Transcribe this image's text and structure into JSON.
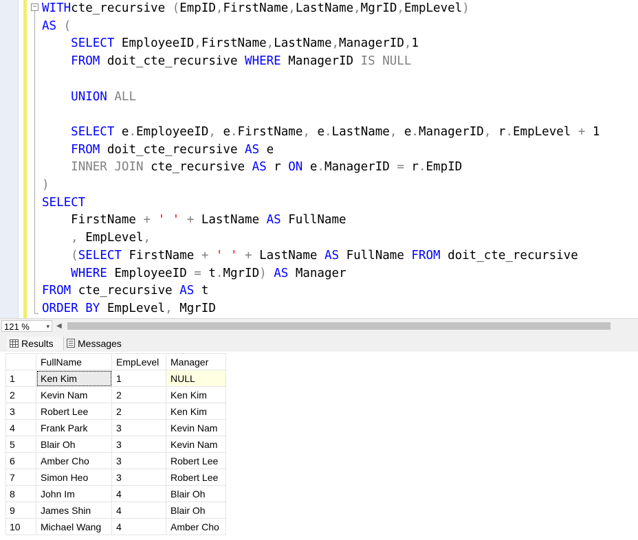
{
  "editor": {
    "fold_toggle": "−",
    "lines": [
      [
        [
          "kw",
          "WITH"
        ],
        [
          "",
          "cte_recursive "
        ],
        [
          "gr",
          "("
        ],
        [
          "",
          "EmpID"
        ],
        [
          "gr",
          ","
        ],
        [
          "",
          "FirstName"
        ],
        [
          "gr",
          ","
        ],
        [
          "",
          "LastName"
        ],
        [
          "gr",
          ","
        ],
        [
          "",
          "MgrID"
        ],
        [
          "gr",
          ","
        ],
        [
          "",
          "EmpLevel"
        ],
        [
          "gr",
          ")"
        ]
      ],
      [
        [
          "kw",
          "AS "
        ],
        [
          "gr",
          "("
        ]
      ],
      [
        [
          "",
          "    "
        ],
        [
          "kw",
          "SELECT "
        ],
        [
          "",
          "EmployeeID"
        ],
        [
          "gr",
          ","
        ],
        [
          "",
          "FirstName"
        ],
        [
          "gr",
          ","
        ],
        [
          "",
          "LastName"
        ],
        [
          "gr",
          ","
        ],
        [
          "",
          "ManagerID"
        ],
        [
          "gr",
          ","
        ],
        [
          "",
          "1"
        ]
      ],
      [
        [
          "",
          "    "
        ],
        [
          "kw",
          "FROM "
        ],
        [
          "",
          "doit_cte_recursive "
        ],
        [
          "kw",
          "WHERE "
        ],
        [
          "",
          "ManagerID "
        ],
        [
          "gr",
          "IS NULL"
        ]
      ],
      [],
      [
        [
          "",
          "    "
        ],
        [
          "kw",
          "UNION "
        ],
        [
          "gr",
          "ALL"
        ]
      ],
      [],
      [
        [
          "",
          "    "
        ],
        [
          "kw",
          "SELECT "
        ],
        [
          "",
          "e"
        ],
        [
          "gr",
          "."
        ],
        [
          "",
          "EmployeeID"
        ],
        [
          "gr",
          ", "
        ],
        [
          "",
          "e"
        ],
        [
          "gr",
          "."
        ],
        [
          "",
          "FirstName"
        ],
        [
          "gr",
          ", "
        ],
        [
          "",
          "e"
        ],
        [
          "gr",
          "."
        ],
        [
          "",
          "LastName"
        ],
        [
          "gr",
          ", "
        ],
        [
          "",
          "e"
        ],
        [
          "gr",
          "."
        ],
        [
          "",
          "ManagerID"
        ],
        [
          "gr",
          ", "
        ],
        [
          "",
          "r"
        ],
        [
          "gr",
          "."
        ],
        [
          "",
          "EmpLevel "
        ],
        [
          "gr",
          "+ "
        ],
        [
          "",
          "1"
        ]
      ],
      [
        [
          "",
          "    "
        ],
        [
          "kw",
          "FROM "
        ],
        [
          "",
          "doit_cte_recursive "
        ],
        [
          "kw",
          "AS "
        ],
        [
          "",
          "e"
        ]
      ],
      [
        [
          "",
          "    "
        ],
        [
          "gr",
          "INNER JOIN "
        ],
        [
          "",
          "cte_recursive "
        ],
        [
          "kw",
          "AS "
        ],
        [
          "",
          "r "
        ],
        [
          "kw",
          "ON "
        ],
        [
          "",
          "e"
        ],
        [
          "gr",
          "."
        ],
        [
          "",
          "ManagerID "
        ],
        [
          "gr",
          "= "
        ],
        [
          "",
          "r"
        ],
        [
          "gr",
          "."
        ],
        [
          "",
          "EmpID"
        ]
      ],
      [
        [
          "gr",
          ")"
        ]
      ],
      [
        [
          "kw",
          "SELECT"
        ]
      ],
      [
        [
          "",
          "    FirstName "
        ],
        [
          "gr",
          "+ "
        ],
        [
          "st",
          "' '"
        ],
        [
          "gr",
          " + "
        ],
        [
          "",
          "LastName "
        ],
        [
          "kw",
          "AS "
        ],
        [
          "",
          "FullName"
        ]
      ],
      [
        [
          "",
          "    "
        ],
        [
          "gr",
          ", "
        ],
        [
          "",
          "EmpLevel"
        ],
        [
          "gr",
          ","
        ]
      ],
      [
        [
          "",
          "    "
        ],
        [
          "gr",
          "("
        ],
        [
          "kw",
          "SELECT "
        ],
        [
          "",
          "FirstName "
        ],
        [
          "gr",
          "+ "
        ],
        [
          "st",
          "' '"
        ],
        [
          "gr",
          " + "
        ],
        [
          "",
          "LastName "
        ],
        [
          "kw",
          "AS "
        ],
        [
          "",
          "FullName "
        ],
        [
          "kw",
          "FROM "
        ],
        [
          "",
          "doit_cte_recursive"
        ]
      ],
      [
        [
          "",
          "    "
        ],
        [
          "kw",
          "WHERE "
        ],
        [
          "",
          "EmployeeID "
        ],
        [
          "gr",
          "= "
        ],
        [
          "",
          "t"
        ],
        [
          "gr",
          "."
        ],
        [
          "",
          "MgrID"
        ],
        [
          "gr",
          ") "
        ],
        [
          "kw",
          "AS "
        ],
        [
          "",
          "Manager"
        ]
      ],
      [
        [
          "kw",
          "FROM "
        ],
        [
          "",
          "cte_recursive "
        ],
        [
          "kw",
          "AS "
        ],
        [
          "",
          "t"
        ]
      ],
      [
        [
          "kw",
          "ORDER BY "
        ],
        [
          "",
          "EmpLevel"
        ],
        [
          "gr",
          ", "
        ],
        [
          "",
          "MgrID"
        ]
      ]
    ]
  },
  "zoom": {
    "value": "121 %",
    "arrow": "▾"
  },
  "tabs": {
    "results": "Results",
    "messages": "Messages"
  },
  "grid": {
    "columns": [
      "FullName",
      "EmpLevel",
      "Manager"
    ],
    "rows": [
      [
        "1",
        "Ken Kim",
        "1",
        "NULL"
      ],
      [
        "2",
        "Kevin Nam",
        "2",
        "Ken Kim"
      ],
      [
        "3",
        "Robert Lee",
        "2",
        "Ken Kim"
      ],
      [
        "4",
        "Frank Park",
        "3",
        "Kevin Nam"
      ],
      [
        "5",
        "Blair Oh",
        "3",
        "Kevin Nam"
      ],
      [
        "6",
        "Amber Cho",
        "3",
        "Robert Lee"
      ],
      [
        "7",
        "Simon Heo",
        "3",
        "Robert Lee"
      ],
      [
        "8",
        "John Im",
        "4",
        "Blair Oh"
      ],
      [
        "9",
        "James Shin",
        "4",
        "Blair Oh"
      ],
      [
        "10",
        "Michael Wang",
        "4",
        "Amber Cho"
      ]
    ]
  }
}
